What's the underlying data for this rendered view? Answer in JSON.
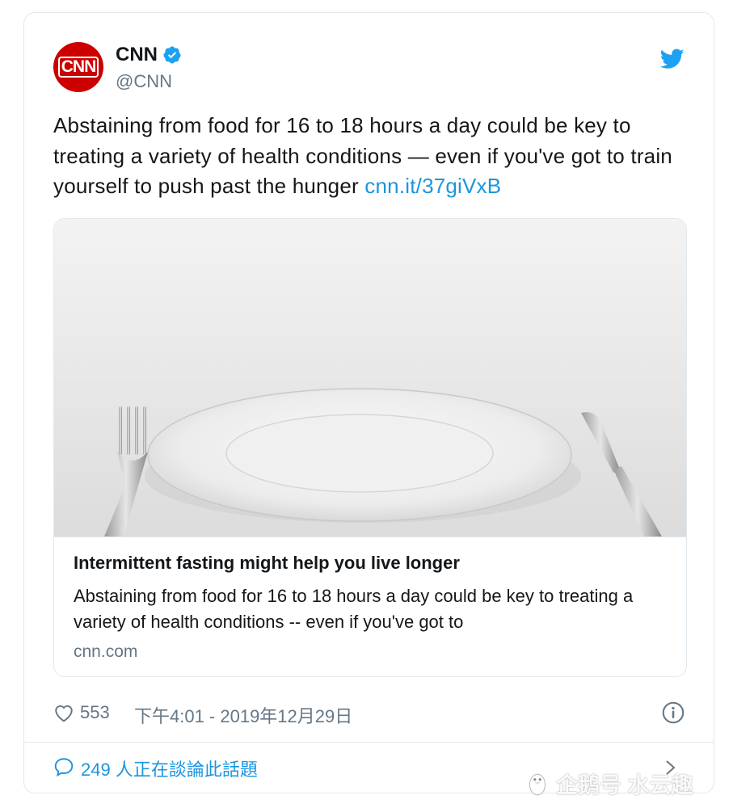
{
  "tweet": {
    "display_name": "CNN",
    "handle": "@CNN",
    "avatar_text": "CNN",
    "text": "Abstaining from food for 16 to 18 hours a day could be key to treating a variety of health conditions — even if you've got to train yourself to push past the hunger ",
    "link": "cnn.it/37giVxB"
  },
  "card": {
    "image_alt": "empty white plate with fork and knife",
    "title": "Intermittent fasting might help you live longer",
    "description": "Abstaining from food for 16 to 18 hours a day could be key to treating a variety of health conditions -- even if you've got to",
    "domain": "cnn.com"
  },
  "meta": {
    "likes": "553",
    "timestamp": "下午4:01 - 2019年12月29日"
  },
  "footer": {
    "discussion": "249 人正在談論此話題"
  },
  "watermark": {
    "text": "企鹅号 水云趣"
  },
  "colors": {
    "accent": "#1b95e0",
    "text": "#14171a",
    "secondary": "#657786",
    "cnn_red": "#cc0000",
    "border": "#e1e8ed"
  },
  "icons": [
    "verified-badge-icon",
    "twitter-bird-icon",
    "heart-icon",
    "info-icon",
    "reply-bubble-icon",
    "chevron-right-icon",
    "penguin-icon"
  ]
}
